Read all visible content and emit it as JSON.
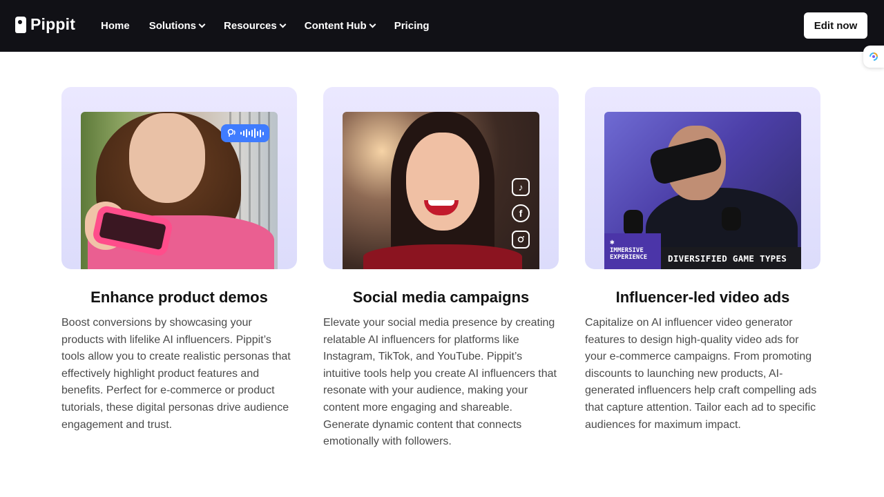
{
  "nav": {
    "logo_text": "Pippit",
    "items": [
      {
        "label": "Home",
        "has_dropdown": false
      },
      {
        "label": "Solutions",
        "has_dropdown": true
      },
      {
        "label": "Resources",
        "has_dropdown": true
      },
      {
        "label": "Content Hub",
        "has_dropdown": true
      },
      {
        "label": "Pricing",
        "has_dropdown": false
      }
    ],
    "cta_label": "Edit now"
  },
  "cards": [
    {
      "title": "Enhance product demos",
      "description": "Boost conversions by showcasing your products with lifelike AI influencers. Pippit’s tools allow you to create realistic personas that effectively highlight product features and benefits. Perfect for e-commerce or product tutorials, these digital personas drive audience engagement and trust.",
      "image_icons": [
        "voice-icon",
        "audio-wave-icon"
      ]
    },
    {
      "title": "Social media campaigns",
      "description": "Elevate your social media presence by creating relatable AI influencers for platforms like Instagram, TikTok, and YouTube. Pippit’s intuitive tools help you create AI influencers that resonate with your audience, making your content more engaging and shareable. Generate dynamic content that connects emotionally with followers.",
      "image_icons": [
        "tiktok-icon",
        "facebook-icon",
        "instagram-icon"
      ]
    },
    {
      "title": "Influencer-led video ads",
      "description": "Capitalize on AI influencer video generator features to design high-quality video ads for your e-commerce campaigns. From promoting discounts to launching new products, AI-generated influencers help craft compelling ads that capture attention. Tailor each ad to specific audiences for maximum impact.",
      "image_badges": {
        "left": "IMMERSIVE EXPERIENCE",
        "right": "DIVERSIFIED GAME TYPES"
      }
    }
  ],
  "colors": {
    "nav_bg": "#111116",
    "card_bg": "#e4e2fd",
    "voice_pill": "#3f7cff",
    "badge_purple": "#4b35a8"
  }
}
